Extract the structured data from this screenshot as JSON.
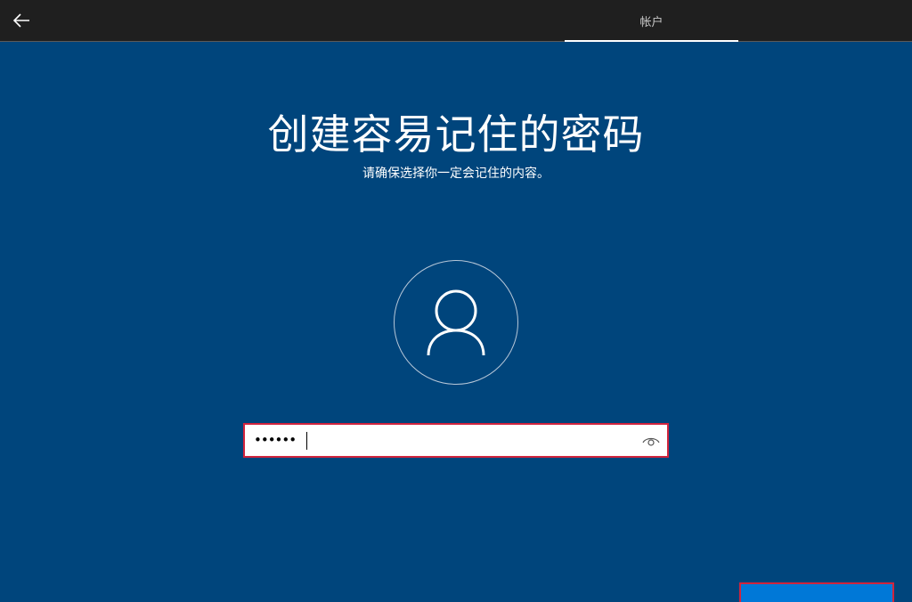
{
  "header": {
    "tab_label": "帐户",
    "back_icon": "back-arrow-icon"
  },
  "main": {
    "title": "创建容易记住的密码",
    "subtitle": "请确保选择你一定会记住的内容。"
  },
  "avatar": {
    "icon": "user-icon"
  },
  "password_field": {
    "masked_value": "••••••",
    "reveal_icon": "eye-icon"
  },
  "next_button": {
    "label": ""
  },
  "colors": {
    "background": "#00457c",
    "topbar": "#1f1f1f",
    "focus_border": "#d1243d",
    "button_blue": "#0078d7"
  }
}
